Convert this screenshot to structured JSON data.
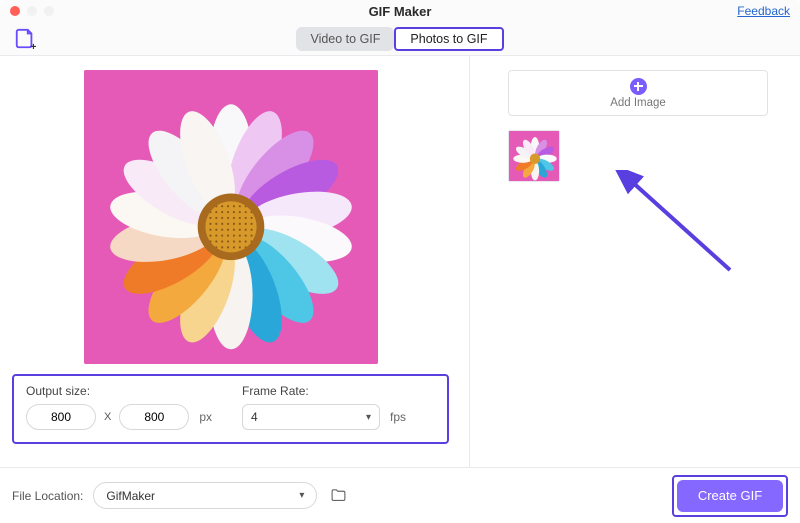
{
  "window": {
    "title": "GIF Maker",
    "feedback_label": "Feedback"
  },
  "tabs": {
    "video": "Video to GIF",
    "photos": "Photos to GIF"
  },
  "settings": {
    "output_label": "Output size:",
    "width": "800",
    "height": "800",
    "x_sep": "X",
    "px_unit": "px",
    "framerate_label": "Frame Rate:",
    "framerate_value": "4",
    "fps_unit": "fps"
  },
  "right": {
    "add_image_label": "Add Image"
  },
  "footer": {
    "location_label": "File Location:",
    "location_value": "GifMaker",
    "create_label": "Create GIF"
  }
}
